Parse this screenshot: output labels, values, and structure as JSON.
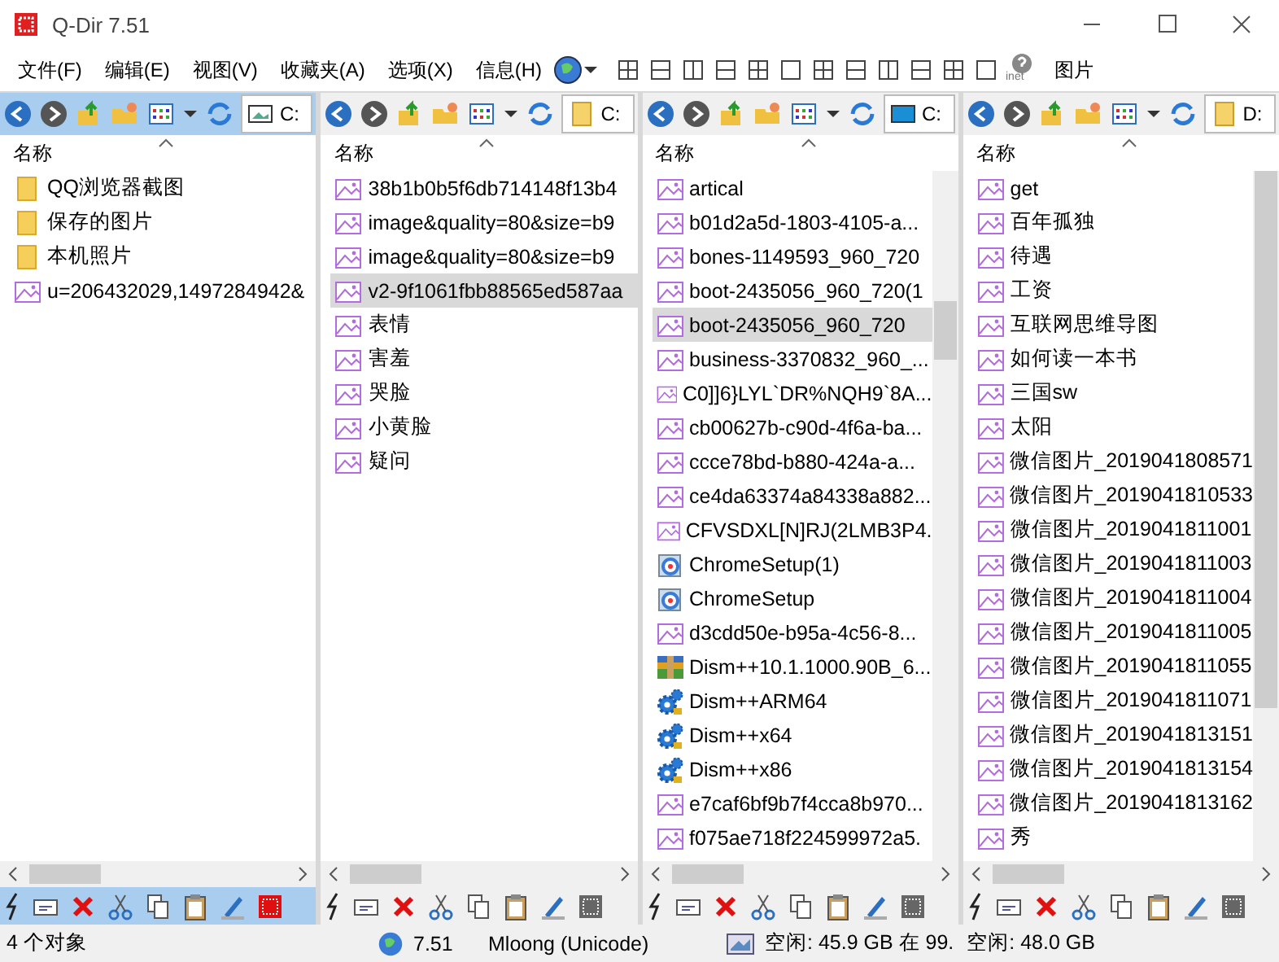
{
  "window": {
    "title": "Q-Dir 7.51"
  },
  "menu": [
    "文件(F)",
    "编辑(E)",
    "视图(V)",
    "收藏夹(A)",
    "选项(X)",
    "信息(H)"
  ],
  "toolbar": {
    "help_caption": "inet",
    "label": "图片"
  },
  "panes": [
    {
      "active": true,
      "path": {
        "text": "C:",
        "kind": "picture"
      },
      "header": "名称",
      "vscroll": false,
      "files": [
        {
          "name": "QQ浏览器截图",
          "kind": "folder",
          "selected": false
        },
        {
          "name": "保存的图片",
          "kind": "folder",
          "selected": false
        },
        {
          "name": "本机照片",
          "kind": "folder",
          "selected": false
        },
        {
          "name": "u=206432029,1497284942&",
          "kind": "image",
          "selected": false
        }
      ]
    },
    {
      "active": false,
      "path": {
        "text": "C:",
        "kind": "folder"
      },
      "header": "名称",
      "vscroll": false,
      "files": [
        {
          "name": "38b1b0b5f6db714148f13b4",
          "kind": "image",
          "selected": false
        },
        {
          "name": "image&quality=80&size=b9",
          "kind": "image",
          "selected": false
        },
        {
          "name": "image&quality=80&size=b9",
          "kind": "image",
          "selected": false
        },
        {
          "name": "v2-9f1061fbb88565ed587aa",
          "kind": "image",
          "selected": true
        },
        {
          "name": "表情",
          "kind": "image",
          "selected": false
        },
        {
          "name": "害羞",
          "kind": "image",
          "selected": false
        },
        {
          "name": "哭脸",
          "kind": "image",
          "selected": false
        },
        {
          "name": "小黄脸",
          "kind": "image",
          "selected": false
        },
        {
          "name": "疑问",
          "kind": "image",
          "selected": false
        }
      ]
    },
    {
      "active": false,
      "path": {
        "text": "C:",
        "kind": "monitor"
      },
      "header": "名称",
      "vscroll": true,
      "files": [
        {
          "name": "artical",
          "kind": "image",
          "selected": false
        },
        {
          "name": "b01d2a5d-1803-4105-a...",
          "kind": "image",
          "selected": false
        },
        {
          "name": "bones-1149593_960_720",
          "kind": "image",
          "selected": false
        },
        {
          "name": "boot-2435056_960_720(1",
          "kind": "image",
          "selected": false
        },
        {
          "name": "boot-2435056_960_720",
          "kind": "image",
          "selected": true
        },
        {
          "name": "business-3370832_960_...",
          "kind": "image",
          "selected": false
        },
        {
          "name": "C0]]6}LYL`DR%NQH9`8A...",
          "kind": "image",
          "selected": false
        },
        {
          "name": "cb00627b-c90d-4f6a-ba...",
          "kind": "image",
          "selected": false
        },
        {
          "name": "ccce78bd-b880-424a-a...",
          "kind": "image",
          "selected": false
        },
        {
          "name": "ce4da63374a84338a882...",
          "kind": "image",
          "selected": false
        },
        {
          "name": "CFVSDXL[N]RJ(2LMB3P4.",
          "kind": "image",
          "selected": false
        },
        {
          "name": "ChromeSetup(1)",
          "kind": "setup",
          "selected": false
        },
        {
          "name": "ChromeSetup",
          "kind": "setup",
          "selected": false
        },
        {
          "name": "d3cdd50e-b95a-4c56-8...",
          "kind": "image",
          "selected": false
        },
        {
          "name": "Dism++10.1.1000.90B_6...",
          "kind": "archive",
          "selected": false
        },
        {
          "name": "Dism++ARM64",
          "kind": "gear",
          "selected": false
        },
        {
          "name": "Dism++x64",
          "kind": "gear",
          "selected": false
        },
        {
          "name": "Dism++x86",
          "kind": "gear",
          "selected": false
        },
        {
          "name": "e7caf6bf9b7f4cca8b970...",
          "kind": "image",
          "selected": false
        },
        {
          "name": "f075ae718f224599972a5.",
          "kind": "image",
          "selected": false
        }
      ]
    },
    {
      "active": false,
      "path": {
        "text": "D:",
        "kind": "folder"
      },
      "header": "名称",
      "vscroll": true,
      "files": [
        {
          "name": "get",
          "kind": "image",
          "selected": false
        },
        {
          "name": "百年孤独",
          "kind": "image",
          "selected": false
        },
        {
          "name": "待遇",
          "kind": "image",
          "selected": false
        },
        {
          "name": "工资",
          "kind": "image",
          "selected": false
        },
        {
          "name": "互联网思维导图",
          "kind": "image",
          "selected": false
        },
        {
          "name": "如何读一本书",
          "kind": "image",
          "selected": false
        },
        {
          "name": "三国sw",
          "kind": "image",
          "selected": false
        },
        {
          "name": "太阳",
          "kind": "image",
          "selected": false
        },
        {
          "name": "微信图片_2019041808571",
          "kind": "image",
          "selected": false
        },
        {
          "name": "微信图片_2019041810533",
          "kind": "image",
          "selected": false
        },
        {
          "name": "微信图片_2019041811001",
          "kind": "image",
          "selected": false
        },
        {
          "name": "微信图片_2019041811003",
          "kind": "image",
          "selected": false
        },
        {
          "name": "微信图片_2019041811004",
          "kind": "image",
          "selected": false
        },
        {
          "name": "微信图片_2019041811005",
          "kind": "image",
          "selected": false
        },
        {
          "name": "微信图片_2019041811055",
          "kind": "image",
          "selected": false
        },
        {
          "name": "微信图片_2019041811071",
          "kind": "image",
          "selected": false
        },
        {
          "name": "微信图片_2019041813151",
          "kind": "image",
          "selected": false
        },
        {
          "name": "微信图片_2019041813154",
          "kind": "image",
          "selected": false
        },
        {
          "name": "微信图片_2019041813162",
          "kind": "image",
          "selected": false
        },
        {
          "name": "秀",
          "kind": "image",
          "selected": false
        }
      ]
    }
  ],
  "status_bar": {
    "count": "4 个对象",
    "version": "7.51",
    "author": "Mloong (Unicode)",
    "free_1": "空闲: 45.9 GB 在 99.",
    "free_2": "空闲: 48.0 GB"
  }
}
